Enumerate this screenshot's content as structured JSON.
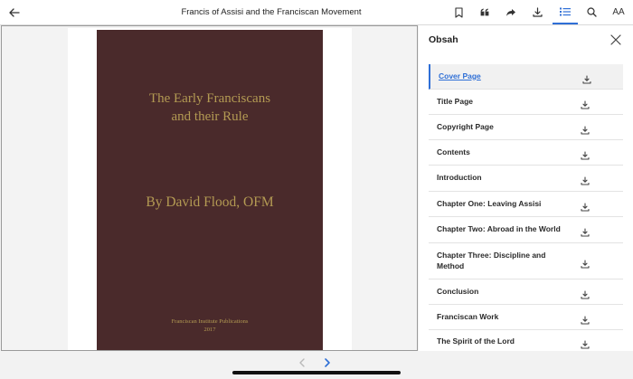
{
  "header": {
    "title": "Francis of Assisi and the Franciscan Movement",
    "icons": [
      "back-arrow-icon",
      "bookmark-icon",
      "quote-icon",
      "share-icon",
      "download-icon",
      "toc-list-icon",
      "search-icon",
      "text-size-icon"
    ],
    "text_size_label": "AA"
  },
  "cover": {
    "title_line1": "The Early Franciscans",
    "title_line2": "and their Rule",
    "author": "By David Flood, OFM",
    "publisher": "Franciscan Institute Publications",
    "year": "2017"
  },
  "toc": {
    "heading": "Obsah",
    "items": [
      {
        "label": "Cover Page",
        "active": true
      },
      {
        "label": "Title Page"
      },
      {
        "label": "Copyright Page"
      },
      {
        "label": "Contents"
      },
      {
        "label": "Introduction"
      },
      {
        "label": "Chapter One: Leaving Assisi"
      },
      {
        "label": "Chapter Two: Abroad in the World"
      },
      {
        "label": "Chapter Three: Discipline and Method"
      },
      {
        "label": "Conclusion"
      },
      {
        "label": "Franciscan Work"
      },
      {
        "label": "The Spirit of the Lord"
      }
    ]
  },
  "nav": {
    "prev_icon": "chevron-left-icon",
    "next_icon": "chevron-right-icon"
  },
  "colors": {
    "accent": "#2f6fd6",
    "cover_background": "#4a2a2b",
    "cover_text": "#b39a53"
  }
}
